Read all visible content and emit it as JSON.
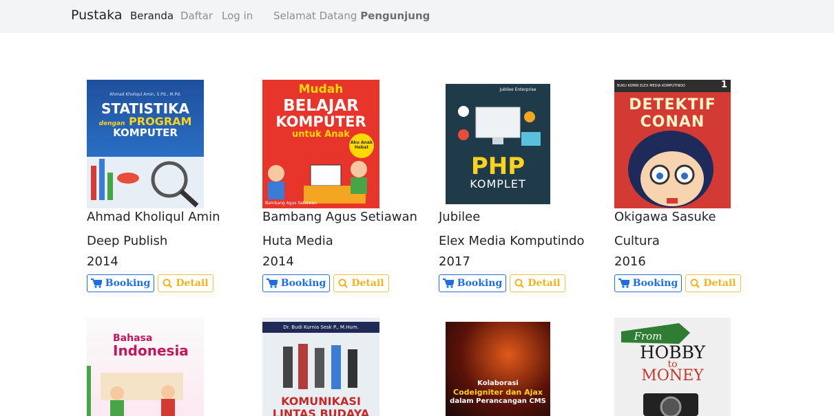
{
  "navbar": {
    "brand": "Pustaka",
    "links": [
      "Beranda",
      "Daftar",
      "Log in"
    ],
    "welcome_prefix": "Selamat Datang",
    "welcome_user": "Pengunjung"
  },
  "buttons": {
    "booking": "Booking",
    "detail": "Detail"
  },
  "books": [
    {
      "author": "Ahmad Kholiqul Amin",
      "publisher": "Deep Publish",
      "year": "2014",
      "cover": {
        "line1": "STATISTIKA",
        "line2": "dengan",
        "line3": "PROGRAM",
        "line4": "KOMPUTER",
        "top": "Ahmad Kholiqul Amin, S.Pd., M.Pd."
      }
    },
    {
      "author": "Bambang Agus Setiawan",
      "publisher": "Huta Media",
      "year": "2014",
      "cover": {
        "line1": "Mudah",
        "line2": "BELAJAR",
        "line3": "KOMPUTER",
        "line4": "untuk Anak",
        "badge": "Aku Anak Hebat",
        "bottom": "Bambang Agus Setiawan"
      }
    },
    {
      "author": "Jubilee",
      "publisher": "Elex Media Komputindo",
      "year": "2017",
      "cover": {
        "top": "Jubilee Enterprise",
        "line1": "PHP",
        "line2": "KOMPLET"
      }
    },
    {
      "author": "Okigawa Sasuke",
      "publisher": "Cultura",
      "year": "2016",
      "cover": {
        "top": "BUKU KOMIK ELEX MEDIA KOMPUTINDO",
        "volume": "1",
        "title": "DETEKTIF CONAN"
      }
    }
  ],
  "books_row2": [
    {
      "cover": {
        "line1": "Bahasa",
        "line2": "Indonesia"
      }
    },
    {
      "cover": {
        "top": "Dr. Budi Kurnia Sesk P., M.Hum.",
        "line1": "KOMUNIKASI",
        "line2": "LINTAS BUDAYA"
      }
    },
    {
      "cover": {
        "line1": "Kolaborasi",
        "line2": "Codeigniter dan Ajax",
        "line3": "dalam Perancangan CMS"
      }
    },
    {
      "cover": {
        "line1": "From",
        "line2": "HOBBY",
        "line3": "to",
        "line4": "MONEY"
      }
    }
  ],
  "colors": {
    "primary": "#1d6fe0",
    "warning": "#f0b41e",
    "navbar_bg": "#f3f4f6"
  },
  "icons": {
    "booking": "cart-icon",
    "detail": "search-icon"
  }
}
